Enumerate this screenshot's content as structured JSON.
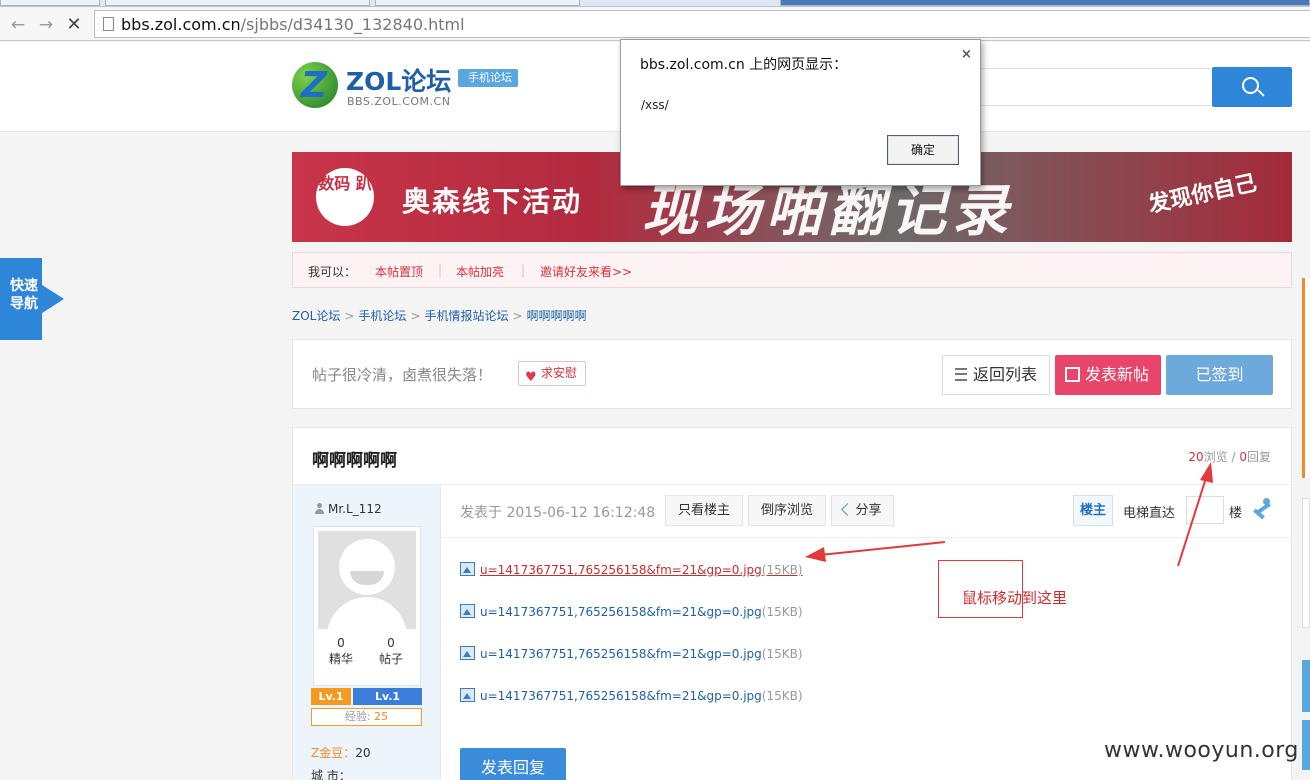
{
  "browser": {
    "url_domain": "bbs.zol.com.cn",
    "url_path": "/sjbbs/d34130_132840.html"
  },
  "header": {
    "logo_text": "ZOL论坛",
    "logo_sub": "BBS.ZOL.COM.CN",
    "logo_badge": "手机论坛",
    "logo_mark": "Z"
  },
  "banner": {
    "circle_text": "数码 趴",
    "line1": "奥森线下活动",
    "line2": "现场啪翻记录",
    "line3": "发现你自己"
  },
  "actionbar": {
    "label": "我可以：",
    "items": [
      "本帖置顶",
      "本帖加亮",
      "邀请好友来看>>"
    ]
  },
  "breadcrumb": [
    "ZOL论坛",
    "手机论坛",
    "手机情报站论坛",
    "啊啊啊啊啊"
  ],
  "quicknav": {
    "label": "快速导航"
  },
  "infobar": {
    "message": "帖子很冷清，卤煮很失落！",
    "comfort": "求安慰",
    "back_label": "返回列表",
    "new_label": "发表新帖",
    "signed_label": "已签到"
  },
  "post": {
    "title": "啊啊啊啊啊",
    "views": "20",
    "views_label": "浏览",
    "replies": "0",
    "replies_label": "回复",
    "posted_at": "发表于 2015-06-12 16:12:48",
    "only_op": "只看楼主",
    "reverse": "倒序浏览",
    "share": "分享",
    "op_badge": "楼主",
    "elevator": "电梯直达",
    "floor": "楼",
    "attachments": [
      {
        "name": "u=1417367751,765256158&fm=21&gp=0.jpg",
        "size": "(15KB)"
      },
      {
        "name": "u=1417367751,765256158&fm=21&gp=0.jpg",
        "size": "(15KB)"
      },
      {
        "name": "u=1417367751,765256158&fm=21&gp=0.jpg",
        "size": "(15KB)"
      },
      {
        "name": "u=1417367751,765256158&fm=21&gp=0.jpg",
        "size": "(15KB)"
      }
    ],
    "reply_button": "发表回复"
  },
  "user": {
    "name": "Mr.L_112",
    "essence_count": "0",
    "essence_label": "精华",
    "posts_count": "0",
    "posts_label": "帖子",
    "lv1": "Lv.1",
    "lv2": "Lv.1",
    "exp_label": "经验:",
    "exp_value": "25",
    "zbean_label": "Z金豆：",
    "zbean_value": "20",
    "city_label": "城 市："
  },
  "annotation": {
    "text": "鼠标移动到这里"
  },
  "watermark": "www.wooyun.org",
  "dialog": {
    "title": "bbs.zol.com.cn 上的网页显示：",
    "message": "/xss/",
    "ok": "确定",
    "close": "×"
  },
  "colors": {
    "accent_blue": "#2f86d9",
    "new_post_pink": "#e9446a",
    "link_red": "#d6323a",
    "annotation_red": "#e23a3a"
  }
}
